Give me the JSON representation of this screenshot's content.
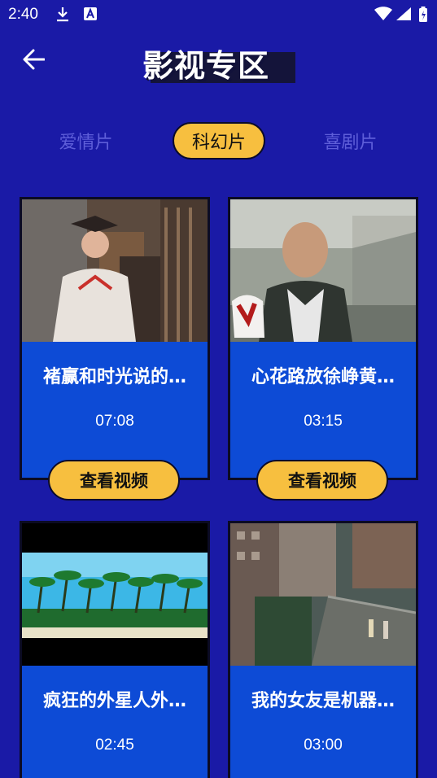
{
  "status_bar": {
    "time": "2:40",
    "icons": [
      "download-icon",
      "a-icon",
      "wifi-icon",
      "signal-icon",
      "battery-icon"
    ]
  },
  "header": {
    "title": "影视专区",
    "back_icon": "arrow-left-icon"
  },
  "tabs": [
    {
      "label": "爱情片",
      "selected": false
    },
    {
      "label": "科幻片",
      "selected": true
    },
    {
      "label": "喜剧片",
      "selected": false
    }
  ],
  "videos": [
    {
      "title": "褚赢和时光说的…",
      "duration": "07:08",
      "button": "查看视频"
    },
    {
      "title": "心花路放徐峥黄…",
      "duration": "03:15",
      "button": "查看视频"
    },
    {
      "title": "疯狂的外星人外…",
      "duration": "02:45"
    },
    {
      "title": "我的女友是机器…",
      "duration": "03:00"
    }
  ],
  "colors": {
    "background": "#1a1aa6",
    "card": "#0d4bd6",
    "accent": "#f7bf3f",
    "inactive_tab": "#5e5ed9"
  }
}
